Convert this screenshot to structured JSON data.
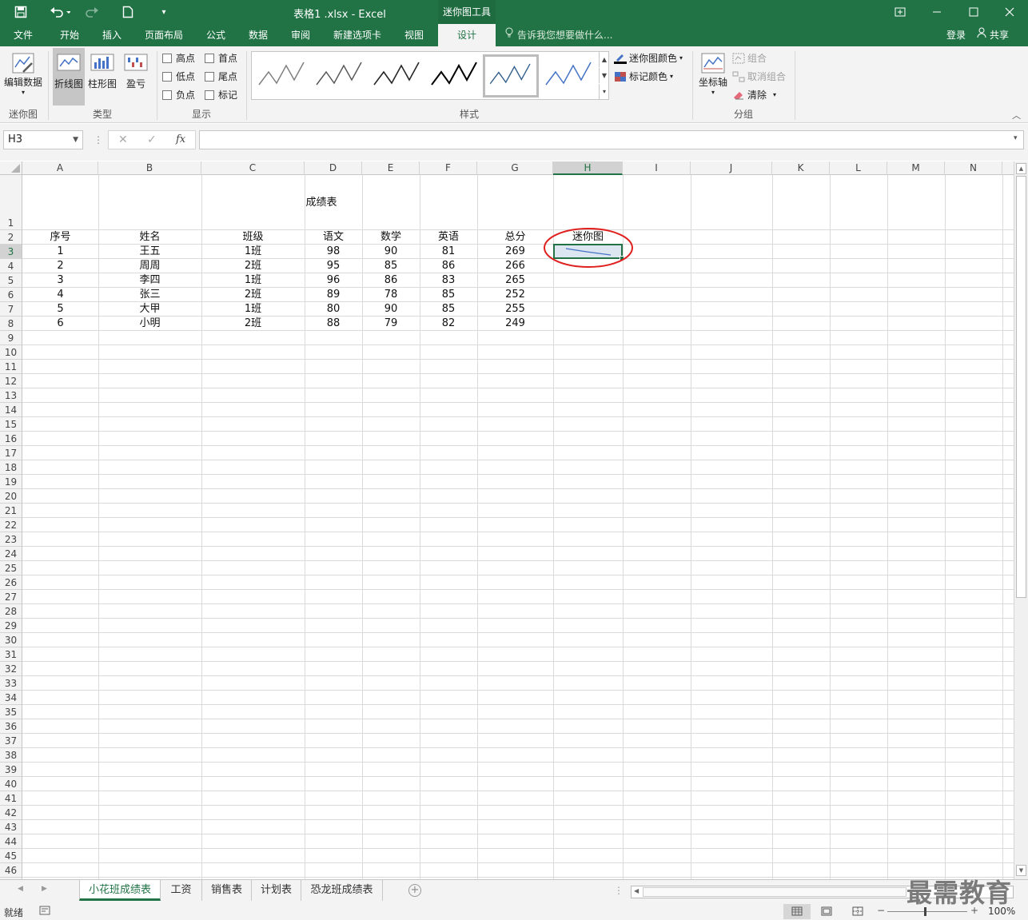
{
  "titlebar": {
    "doc_title": "表格1 .xlsx - Excel",
    "context_title": "迷你图工具"
  },
  "tabs": [
    "文件",
    "开始",
    "插入",
    "页面布局",
    "公式",
    "数据",
    "审阅",
    "新建选项卡",
    "视图",
    "设计"
  ],
  "active_tab": "设计",
  "tell_me": "告诉我您想要做什么...",
  "signin": "登录",
  "share": "共享",
  "ribbon": {
    "sparkline_group": {
      "edit_data": "编辑数据",
      "label": "迷你图"
    },
    "type_group": {
      "line": "折线图",
      "column": "柱形图",
      "winloss": "盈亏",
      "label": "类型"
    },
    "show_group": {
      "high": "高点",
      "first": "首点",
      "low": "低点",
      "last": "尾点",
      "negative": "负点",
      "markers": "标记",
      "label": "显示"
    },
    "style_group": {
      "label": "样式",
      "sparkline_color": "迷你图颜色",
      "marker_color": "标记颜色"
    },
    "group_group": {
      "axis": "坐标轴",
      "group": "组合",
      "ungroup": "取消组合",
      "clear": "清除",
      "label": "分组"
    }
  },
  "formula_bar": {
    "name_box": "H3",
    "formula": ""
  },
  "columns": [
    "A",
    "B",
    "C",
    "D",
    "E",
    "F",
    "G",
    "H",
    "I",
    "J",
    "K",
    "L",
    "M",
    "N"
  ],
  "selected_column": "H",
  "selected_row": "3",
  "rows": [
    "1",
    "2",
    "3",
    "4",
    "5",
    "6",
    "7",
    "8",
    "9",
    "10",
    "11",
    "12",
    "13",
    "14",
    "15",
    "16",
    "17",
    "18",
    "19",
    "20",
    "21",
    "22",
    "23",
    "24",
    "25",
    "26",
    "27",
    "28",
    "29",
    "30",
    "31",
    "32",
    "33",
    "34",
    "35",
    "36",
    "37",
    "38",
    "39",
    "40",
    "41",
    "42",
    "43",
    "44",
    "45",
    "46"
  ],
  "sheet": {
    "title": "成绩表",
    "headers": [
      "序号",
      "姓名",
      "班级",
      "语文",
      "数学",
      "英语",
      "总分",
      "迷你图"
    ],
    "data": [
      [
        "1",
        "王五",
        "1班",
        "98",
        "90",
        "81",
        "269"
      ],
      [
        "2",
        "周周",
        "2班",
        "95",
        "85",
        "86",
        "266"
      ],
      [
        "3",
        "李四",
        "1班",
        "96",
        "86",
        "83",
        "265"
      ],
      [
        "4",
        "张三",
        "2班",
        "89",
        "78",
        "85",
        "252"
      ],
      [
        "5",
        "大甲",
        "1班",
        "80",
        "90",
        "85",
        "255"
      ],
      [
        "6",
        "小明",
        "2班",
        "88",
        "79",
        "82",
        "249"
      ]
    ]
  },
  "sheet_tabs": [
    "小花班成绩表",
    "工资",
    "销售表",
    "计划表",
    "恐龙班成绩表"
  ],
  "active_sheet": "小花班成绩表",
  "status": {
    "ready": "就绪",
    "zoom": "100%"
  },
  "watermark": "最需教育",
  "colors": {
    "excel_green": "#217346",
    "sparkline": "#4472c4",
    "annotation_circle": "#e0201f"
  }
}
